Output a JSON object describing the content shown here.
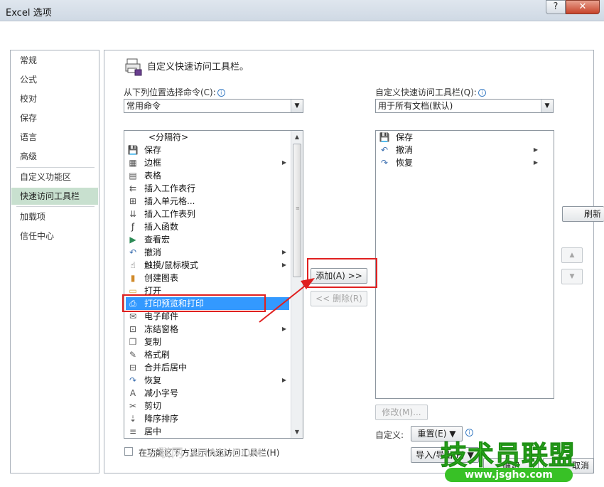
{
  "window": {
    "title": "Excel 选项",
    "help": "?",
    "close": "✕"
  },
  "sidebar": {
    "items": [
      {
        "label": "常规",
        "active": false
      },
      {
        "label": "公式",
        "active": false
      },
      {
        "label": "校对",
        "active": false
      },
      {
        "label": "保存",
        "active": false
      },
      {
        "label": "语言",
        "active": false
      },
      {
        "label": "高级",
        "active": false
      },
      {
        "label": "自定义功能区",
        "active": false
      },
      {
        "label": "快速访问工具栏",
        "active": true
      },
      {
        "label": "加载项",
        "active": false
      },
      {
        "label": "信任中心",
        "active": false
      }
    ]
  },
  "main": {
    "title": "自定义快速访问工具栏。",
    "left_label": "从下列位置选择命令(C):",
    "left_combo": "常用命令",
    "right_label": "自定义快速访问工具栏(Q):",
    "right_combo": "用于所有文档(默认)",
    "commands": [
      {
        "label": "<分隔符>",
        "icon": "",
        "submenu": false
      },
      {
        "label": "保存",
        "icon": "save-icon",
        "submenu": false
      },
      {
        "label": "边框",
        "icon": "border-icon",
        "submenu": true
      },
      {
        "label": "表格",
        "icon": "table-icon",
        "submenu": false
      },
      {
        "label": "插入工作表行",
        "icon": "insert-row-icon",
        "submenu": false
      },
      {
        "label": "插入单元格...",
        "icon": "insert-cell-icon",
        "submenu": false
      },
      {
        "label": "插入工作表列",
        "icon": "insert-column-icon",
        "submenu": false
      },
      {
        "label": "插入函数",
        "icon": "function-icon",
        "submenu": false
      },
      {
        "label": "查看宏",
        "icon": "macro-icon",
        "submenu": false
      },
      {
        "label": "撤消",
        "icon": "undo-icon",
        "submenu": true
      },
      {
        "label": "触摸/鼠标模式",
        "icon": "touch-mode-icon",
        "submenu": true
      },
      {
        "label": "创建图表",
        "icon": "chart-icon",
        "submenu": false
      },
      {
        "label": "打开",
        "icon": "folder-icon",
        "submenu": false
      },
      {
        "label": "打印预览和打印",
        "icon": "print-preview-icon",
        "submenu": false,
        "selected": true
      },
      {
        "label": "电子邮件",
        "icon": "email-icon",
        "submenu": false
      },
      {
        "label": "冻结窗格",
        "icon": "freeze-panes-icon",
        "submenu": true
      },
      {
        "label": "复制",
        "icon": "copy-icon",
        "submenu": false
      },
      {
        "label": "格式刷",
        "icon": "format-painter-icon",
        "submenu": false
      },
      {
        "label": "合并后居中",
        "icon": "merge-center-icon",
        "submenu": false
      },
      {
        "label": "恢复",
        "icon": "redo-icon",
        "submenu": true
      },
      {
        "label": "减小字号",
        "icon": "font-decrease-icon",
        "submenu": false
      },
      {
        "label": "剪切",
        "icon": "scissors-icon",
        "submenu": false
      },
      {
        "label": "降序排序",
        "icon": "sort-desc-icon",
        "submenu": false
      },
      {
        "label": "居中",
        "icon": "align-center-icon",
        "submenu": false
      }
    ],
    "toolbar_items": [
      {
        "label": "保存",
        "icon": "save-icon",
        "submenu": false
      },
      {
        "label": "撤消",
        "icon": "undo-icon",
        "submenu": true
      },
      {
        "label": "恢复",
        "icon": "redo-icon",
        "submenu": true
      }
    ],
    "add_button": "添加(A) >>",
    "remove_button": "<< 删除(R)",
    "modify_button": "修改(M)...",
    "customize_label": "自定义:",
    "reset_button": "重置(E) ▼",
    "import_export_button": "导入/导出(P) ▼",
    "checkbox_label": "在功能区下方显示快速访问工具栏(H)",
    "refresh_button": "刷新",
    "ok_button": "确定",
    "cancel_button": "取消"
  },
  "watermarks": {
    "faint": "三联网 3LIAN.COM",
    "brand": "技术员联盟",
    "url": "www.jsgho.com"
  },
  "colors": {
    "accent_selection": "#3399ff",
    "nav_active": "#c8e0cf",
    "highlight_box": "#e02020",
    "brand_green": "#38c126"
  }
}
